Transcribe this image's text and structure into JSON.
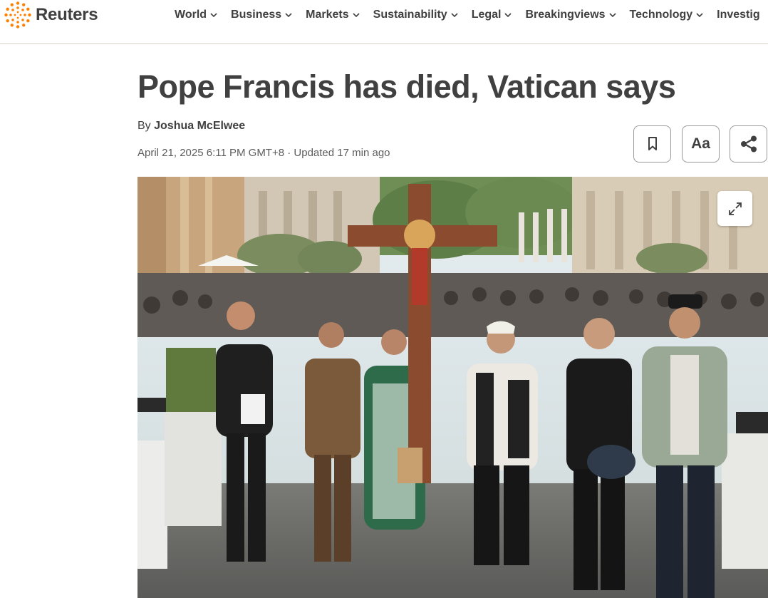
{
  "brand": {
    "name": "Reuters",
    "accent": "#ff8000",
    "logo_icon": "reuters-dots-icon"
  },
  "nav": {
    "items": [
      {
        "label": "World"
      },
      {
        "label": "Business"
      },
      {
        "label": "Markets"
      },
      {
        "label": "Sustainability"
      },
      {
        "label": "Legal"
      },
      {
        "label": "Breakingviews"
      },
      {
        "label": "Technology"
      },
      {
        "label": "Investig"
      }
    ]
  },
  "article": {
    "headline": "Pope Francis has died, Vatican says",
    "byline_prefix": "By",
    "author": "Joshua McElwee",
    "dateline": "April 21, 2025 6:11 PM GMT+8 · Updated 17 min ago"
  },
  "toolbar": {
    "bookmark_icon": "bookmark-icon",
    "text_size_label": "Aa",
    "share_icon": "share-icon"
  },
  "photo": {
    "expand_icon": "expand-icon"
  }
}
